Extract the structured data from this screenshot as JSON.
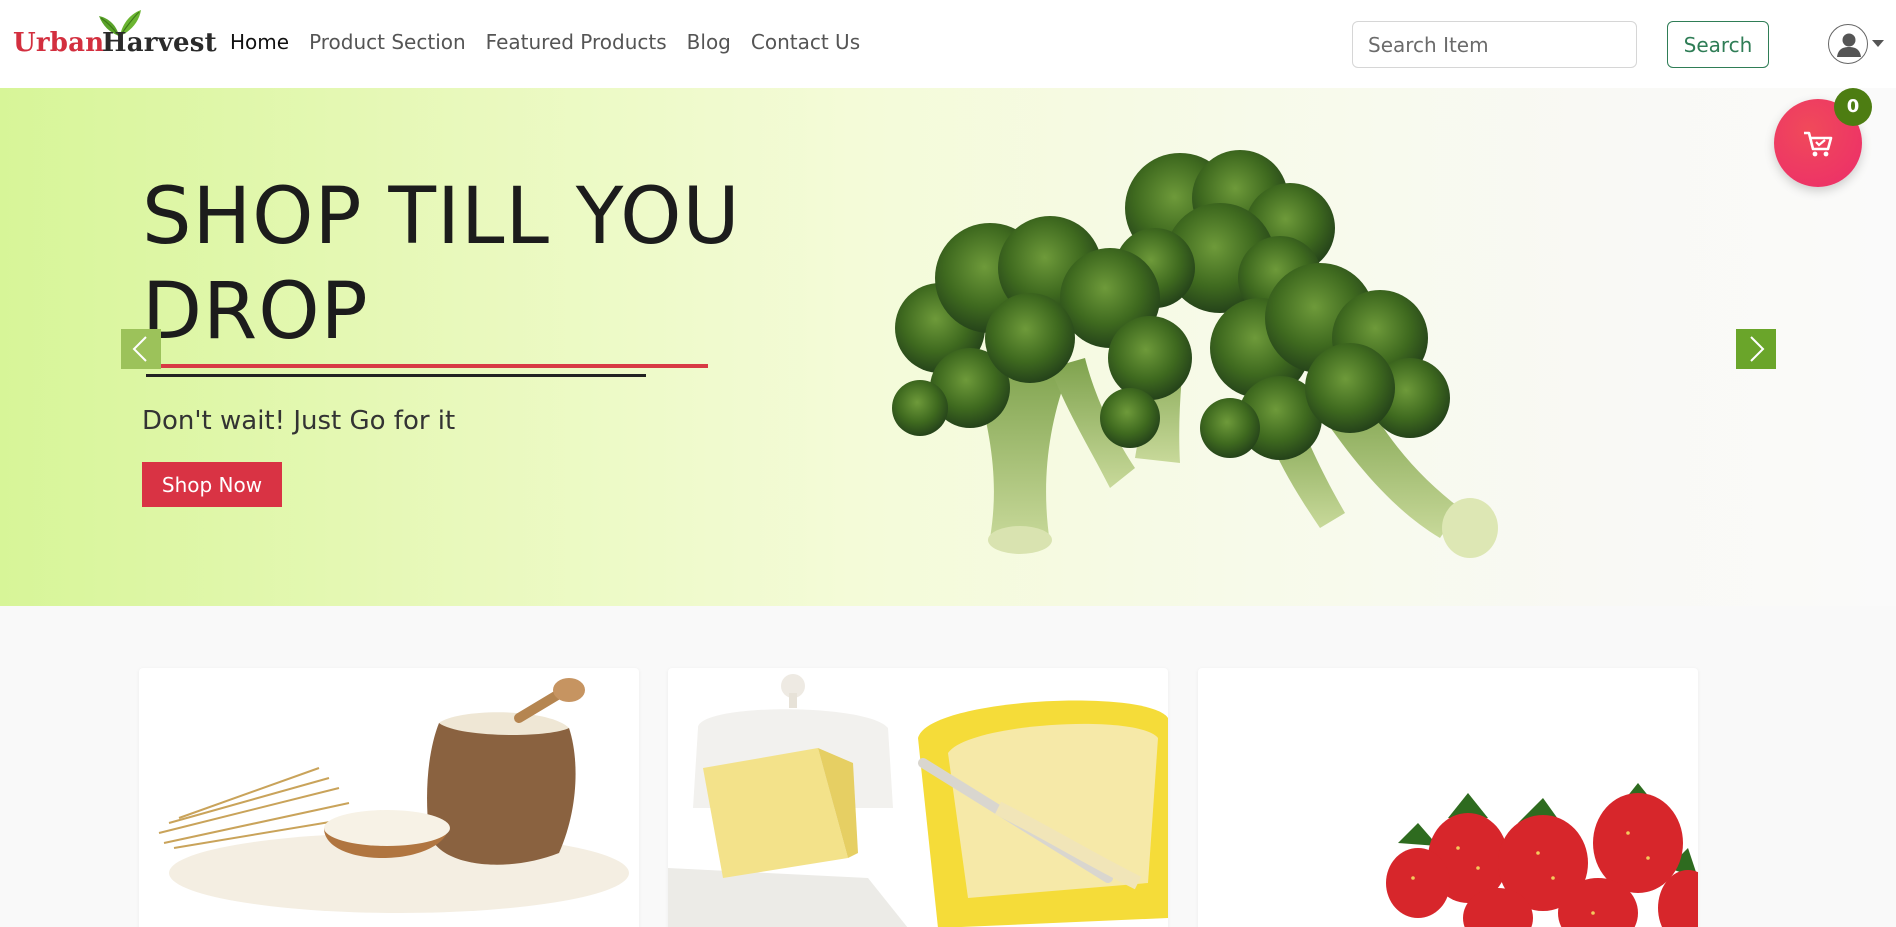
{
  "brand": {
    "word1": "Urban",
    "word2": "Harvest",
    "red": "#d32f3f",
    "leaf_green": "#5aa32a"
  },
  "nav": {
    "links": [
      {
        "label": "Home",
        "active": true
      },
      {
        "label": "Product Section",
        "active": false
      },
      {
        "label": "Featured Products",
        "active": false
      },
      {
        "label": "Blog",
        "active": false
      },
      {
        "label": "Contact Us",
        "active": false
      }
    ],
    "search_placeholder": "Search Item",
    "search_button": "Search",
    "user_icon": "user-circle-icon",
    "caret_icon": "caret-down-icon"
  },
  "hero": {
    "title": "SHOP TILL YOU DROP",
    "subtitle": "Don't wait! Just Go for it",
    "cta": "Shop Now",
    "image": "broccoli",
    "prev_icon": "chevron-left-icon",
    "next_icon": "chevron-right-icon",
    "cta_color": "#d93344"
  },
  "cart": {
    "count": "0",
    "icon": "shopping-cart-icon",
    "badge_color": "#4d7d12"
  },
  "cards": [
    {
      "image": "rice"
    },
    {
      "image": "butter"
    },
    {
      "image": "strawberries"
    }
  ]
}
